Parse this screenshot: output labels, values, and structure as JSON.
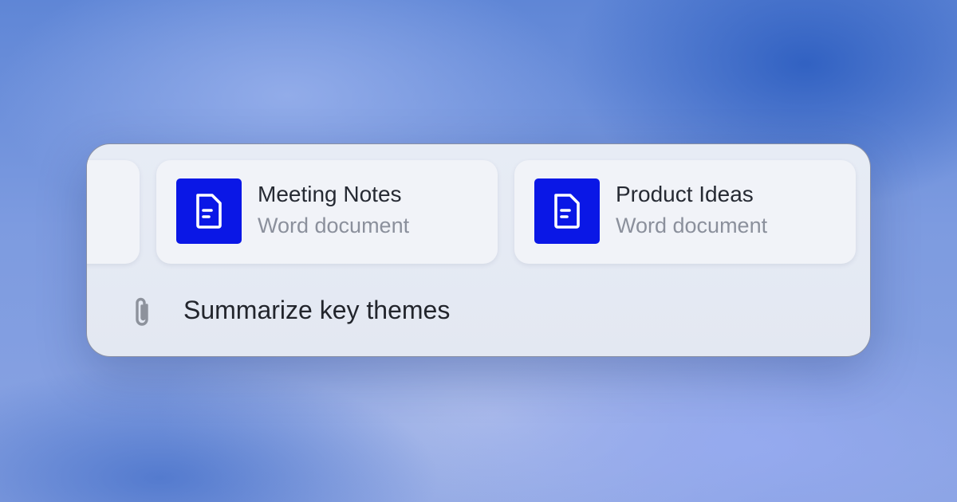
{
  "files": [
    {
      "title": "Meeting Notes",
      "subtitle": "Word document",
      "icon": "document-icon"
    },
    {
      "title": "Product Ideas",
      "subtitle": "Word document",
      "icon": "document-icon"
    }
  ],
  "prompt": {
    "attach_icon": "paperclip-icon",
    "text": "Summarize key themes"
  },
  "colors": {
    "doc_icon_bg": "#0a17e6",
    "panel_bg": "#e5eaf3",
    "card_bg": "#f1f3f8"
  }
}
